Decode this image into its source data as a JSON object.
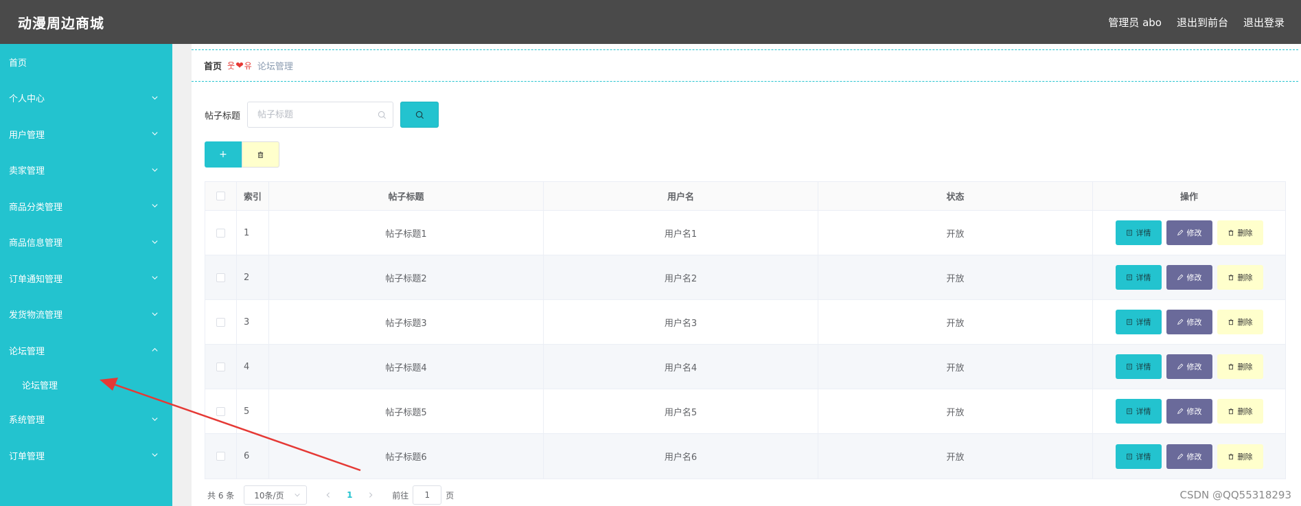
{
  "header": {
    "title": "动漫周边商城",
    "links": [
      "管理员 abo",
      "退出到前台",
      "退出登录"
    ]
  },
  "sidebar": {
    "items": [
      {
        "label": "首页",
        "expandable": false
      },
      {
        "label": "个人中心",
        "expandable": true,
        "expanded": false
      },
      {
        "label": "用户管理",
        "expandable": true,
        "expanded": false
      },
      {
        "label": "卖家管理",
        "expandable": true,
        "expanded": false
      },
      {
        "label": "商品分类管理",
        "expandable": true,
        "expanded": false
      },
      {
        "label": "商品信息管理",
        "expandable": true,
        "expanded": false
      },
      {
        "label": "订单通知管理",
        "expandable": true,
        "expanded": false
      },
      {
        "label": "发货物流管理",
        "expandable": true,
        "expanded": false
      },
      {
        "label": "论坛管理",
        "expandable": true,
        "expanded": true,
        "children": [
          "论坛管理"
        ]
      },
      {
        "label": "系统管理",
        "expandable": true,
        "expanded": false
      },
      {
        "label": "订单管理",
        "expandable": true,
        "expanded": false
      }
    ]
  },
  "breadcrumb": {
    "home": "首页",
    "separator_left": "웃",
    "separator_heart": "❤",
    "separator_right": "유",
    "current": "论坛管理"
  },
  "search": {
    "label": "帖子标题",
    "placeholder": "帖子标题",
    "value": ""
  },
  "actions": {
    "add_label": "+"
  },
  "table": {
    "columns": [
      "",
      "索引",
      "帖子标题",
      "用户名",
      "状态",
      "操作"
    ],
    "rows": [
      {
        "index": "1",
        "title": "帖子标题1",
        "user": "用户名1",
        "status": "开放"
      },
      {
        "index": "2",
        "title": "帖子标题2",
        "user": "用户名2",
        "status": "开放"
      },
      {
        "index": "3",
        "title": "帖子标题3",
        "user": "用户名3",
        "status": "开放"
      },
      {
        "index": "4",
        "title": "帖子标题4",
        "user": "用户名4",
        "status": "开放"
      },
      {
        "index": "5",
        "title": "帖子标题5",
        "user": "用户名5",
        "status": "开放"
      },
      {
        "index": "6",
        "title": "帖子标题6",
        "user": "用户名6",
        "status": "开放"
      }
    ],
    "ops": {
      "detail": "详情",
      "edit": "修改",
      "delete": "删除"
    }
  },
  "pagination": {
    "total": "共 6 条",
    "page_size": "10条/页",
    "current_page": "1",
    "jump_label": "前往",
    "jump_value": "1",
    "jump_suffix": "页"
  },
  "watermark": "CSDN @QQ55318293",
  "colors": {
    "header_bg": "#4a4a4a",
    "sidebar_bg": "#23c3cf",
    "accent": "#23c3cf",
    "edit_btn": "#6a6a9a",
    "delete_btn": "#ffffcc",
    "arrow": "#e53935"
  }
}
